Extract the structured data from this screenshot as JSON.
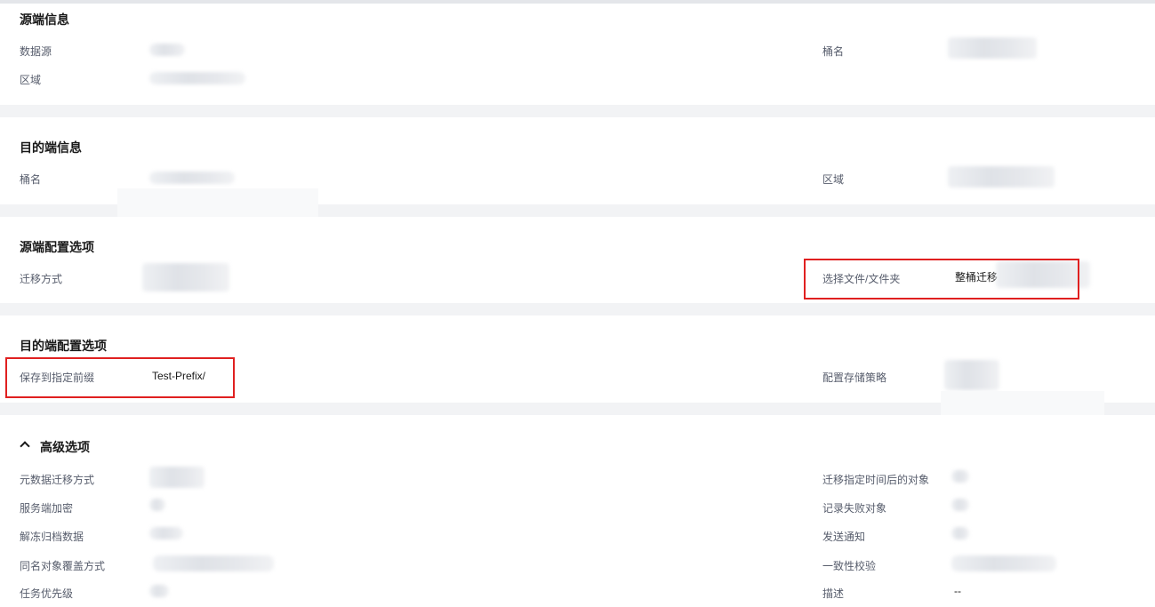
{
  "source_info": {
    "title": "源端信息",
    "data_source_label": "数据源",
    "bucket_label": "桶名",
    "region_label": "区域"
  },
  "dest_info": {
    "title": "目的端信息",
    "bucket_label": "桶名",
    "region_label": "区域"
  },
  "source_config": {
    "title": "源端配置选项",
    "migration_method_label": "迁移方式",
    "select_files_label": "选择文件/文件夹",
    "select_files_value": "整桶迁移"
  },
  "dest_config": {
    "title": "目的端配置选项",
    "save_prefix_label": "保存到指定前缀",
    "save_prefix_value": "Test-Prefix/",
    "storage_policy_label": "配置存储策略"
  },
  "advanced": {
    "title": "高级选项",
    "metadata_migration_label": "元数据迁移方式",
    "migrate_after_time_label": "迁移指定时间后的对象",
    "server_encryption_label": "服务端加密",
    "record_failed_label": "记录失败对象",
    "restore_archive_label": "解冻归档数据",
    "send_notification_label": "发送通知",
    "overwrite_method_label": "同名对象覆盖方式",
    "consistency_check_label": "一致性校验",
    "task_priority_label": "任务优先级",
    "description_label": "描述",
    "description_value": "--"
  }
}
